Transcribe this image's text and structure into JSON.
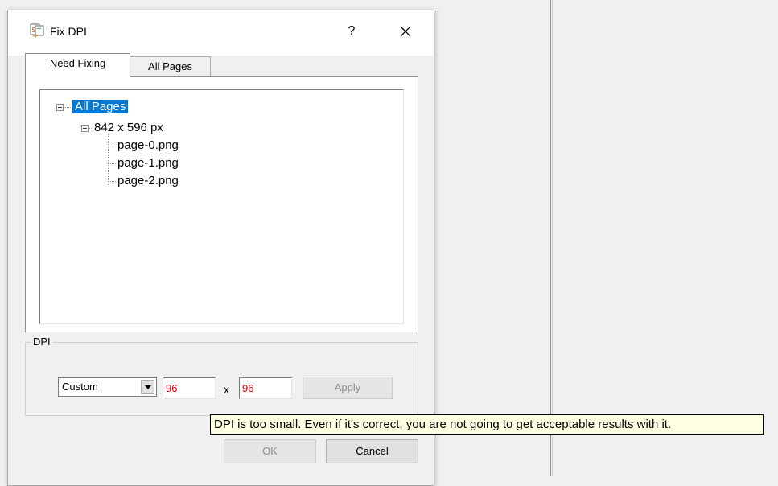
{
  "dialog": {
    "title": "Fix DPI",
    "help_label": "?",
    "close_label": "✕"
  },
  "tabs": [
    {
      "label": "Need Fixing",
      "active": true
    },
    {
      "label": "All Pages",
      "active": false
    }
  ],
  "tree": {
    "root": "All Pages",
    "group": "842 x 596 px",
    "files": [
      "page-0.png",
      "page-1.png",
      "page-2.png"
    ]
  },
  "dpi": {
    "group_label": "DPI",
    "preset": "Custom",
    "x_value": "96",
    "separator": "x",
    "y_value": "96",
    "apply_label": "Apply"
  },
  "tooltip": {
    "text": "DPI is too small. Even if it's correct, you are not going to get acceptable results with it."
  },
  "buttons": {
    "ok_label": "OK",
    "cancel_label": "Cancel"
  },
  "colors": {
    "selection": "#0078d7",
    "invalid_value": "#e00000",
    "tooltip_bg": "#ffffe1"
  }
}
